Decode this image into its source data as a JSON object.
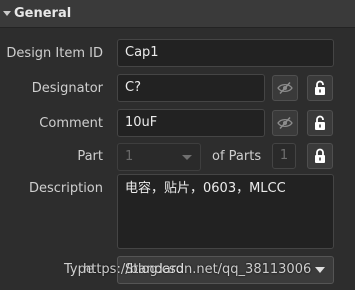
{
  "section": {
    "title": "General"
  },
  "fields": {
    "design_item_id": {
      "label": "Design Item ID",
      "value": "Cap1"
    },
    "designator": {
      "label": "Designator",
      "value": "C?"
    },
    "comment": {
      "label": "Comment",
      "value": "10uF"
    },
    "part": {
      "label": "Part",
      "value": "1",
      "of_parts_label": "of Parts",
      "count": "1"
    },
    "description": {
      "label": "Description",
      "value": "电容，贴片，0603，MLCC"
    },
    "type": {
      "label": "Type",
      "value": "Standard"
    }
  },
  "watermark": "https://blog.csdn.net/qq_38113006",
  "icons": {
    "visibility": "eye-slash-icon",
    "lock": "lock-icon"
  },
  "colors": {
    "background": "#2d2d2d",
    "header": "#3a3a3a",
    "field": "#222222",
    "text": "#ececec"
  }
}
